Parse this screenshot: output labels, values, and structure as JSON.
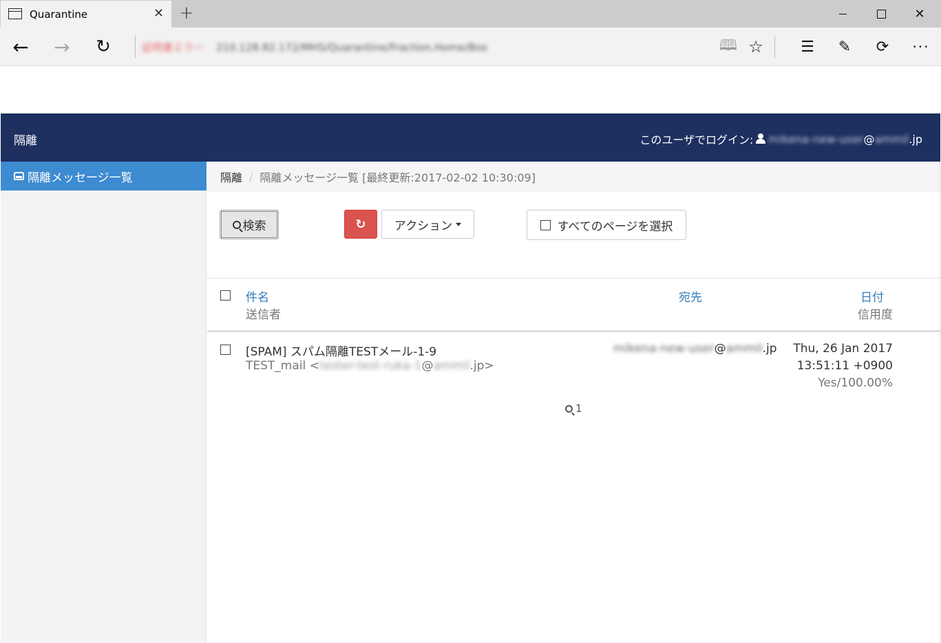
{
  "browser": {
    "tab_title": "Quarantine",
    "new_tab": "+",
    "tab_close": "✕",
    "address_security": "証明書エラー",
    "address_url": "210.128.82.172/MHS/Quarantine/Fraction.Home/Box",
    "icons": [
      "window-icon",
      "back-icon",
      "forward-icon",
      "refresh-icon",
      "reading-view-icon",
      "favorite-icon",
      "hub-icon",
      "web-note-icon",
      "share-icon",
      "more-icon"
    ]
  },
  "navbar": {
    "brand": "隔離",
    "login_label": "このユーザでログイン:",
    "login_user_prefix": "mikena-new-user",
    "login_user_at": "@",
    "login_user_domain": "ammil",
    "login_user_tld": ".jp"
  },
  "sidebar": {
    "items": [
      {
        "label": "隔離メッセージ一覧",
        "active": true,
        "icon": "inbox-icon"
      }
    ]
  },
  "breadcrumb": {
    "root": "隔離",
    "divider": "/",
    "current": "隔離メッセージ一覧 [最終更新:2017-02-02 10:30:09]"
  },
  "toolbar": {
    "search_label": "検索",
    "refresh_icon": "↻",
    "action_label": "アクション",
    "select_all_label": "すべてのページを選択"
  },
  "table": {
    "headers": {
      "subject": "件名",
      "sender": "送信者",
      "recipient": "宛先",
      "date": "日付",
      "score": "信用度"
    },
    "rows": [
      {
        "subject": "[SPAM] スパム隔離TESTメール-1-9",
        "sender_name": "TEST_mail <",
        "sender_local": "tester-test-ruka-1",
        "sender_at": "@",
        "sender_domain": "ammil",
        "sender_tld": ".jp>",
        "recipient_local": "mikena-new-user",
        "recipient_at": "@",
        "recipient_domain": "ammil",
        "recipient_tld": ".jp",
        "date_line1": "Thu, 26 Jan 2017",
        "date_line2": "13:51:11 +0900",
        "score": "Yes/100.00%"
      }
    ]
  },
  "pager": {
    "page": "1"
  },
  "colors": {
    "navbar": "#1e3060",
    "sidebar_active": "#3d8bd0",
    "refresh_button": "#d9534f",
    "link": "#337ab7"
  }
}
